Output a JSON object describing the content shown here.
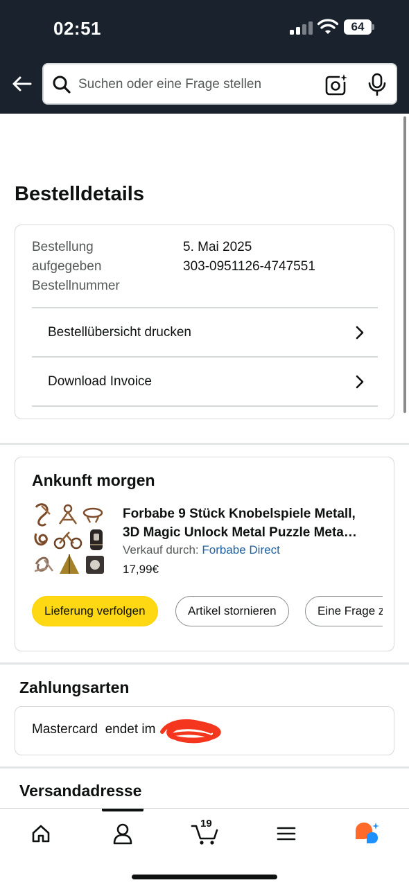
{
  "status_bar": {
    "time": "02:51",
    "battery": "64"
  },
  "header": {
    "search_placeholder": "Suchen oder eine Frage stellen"
  },
  "page": {
    "title": "Bestelldetails"
  },
  "order": {
    "labels": [
      "Bestellung",
      "aufgegeben",
      "Bestellnummer"
    ],
    "date": "5. Mai 2025",
    "number": "303-0951126-4747551",
    "links": [
      "Bestellübersicht drucken",
      "Download Invoice"
    ]
  },
  "arrival": {
    "title": "Ankunft morgen",
    "product_line1": "Forbabe 9 Stück Knobelspiele Metall,",
    "product_line2": "3D Magic Unlock Metal Puzzle Meta…",
    "seller_prefix": "Verkauf durch:",
    "seller_name": "Forbabe Direct",
    "price": "17,99€",
    "buttons": [
      "Lieferung verfolgen",
      "Artikel stornieren",
      "Eine Frage z"
    ]
  },
  "payment": {
    "title": "Zahlungsarten",
    "text": "Mastercard  endet im"
  },
  "shipping": {
    "title": "Versandadresse"
  },
  "tabbar": {
    "cart_count": "19"
  },
  "colors": {
    "header_bg": "#1a222e",
    "primary_button": "#ffd814",
    "link": "#2162a1",
    "ai_orange": "#ff6a2b",
    "ai_blue": "#1e90ff"
  },
  "icons": [
    "back-arrow-icon",
    "search-icon",
    "camera-icon",
    "microphone-icon",
    "chevron-right-icon",
    "home-icon",
    "account-icon",
    "cart-icon",
    "menu-icon",
    "ai-assistant-icon"
  ]
}
